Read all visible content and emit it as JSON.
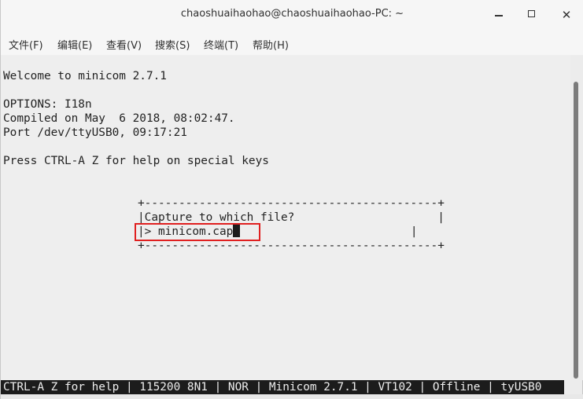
{
  "window": {
    "title": "chaoshuaihaohao@chaoshuaihaohao-PC: ~",
    "minimize_icon": "minimize-icon",
    "maximize_icon": "maximize-icon",
    "close_icon": "close-icon"
  },
  "menu": {
    "items": [
      "文件(F)",
      "编辑(E)",
      "查看(V)",
      "搜索(S)",
      "终端(T)",
      "帮助(H)"
    ]
  },
  "terminal": {
    "lines": [
      "Welcome to minicom 2.7.1",
      "OPTIONS: I18n",
      "Compiled on May  6 2018, 08:02:47.",
      "Port /dev/ttyUSB0, 09:17:21",
      "Press CTRL-A Z for help on special keys"
    ],
    "dialog": {
      "border": "+-------------------------------------------+",
      "prompt": "|Capture to which file?                     |",
      "input_prefix": "|> ",
      "input_value": "minicom.cap",
      "input_suffix": "                         |"
    },
    "status_line": "CTRL-A Z for help | 115200 8N1 | NOR | Minicom 2.7.1 | VT102 | Offline | tyUSB0"
  },
  "colors": {
    "highlight": "#e02020",
    "terminal_bg": "#eeeeee",
    "status_bg": "#1c1c1c"
  }
}
